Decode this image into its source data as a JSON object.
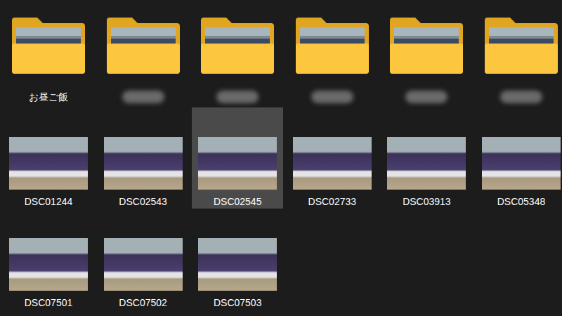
{
  "folders": [
    {
      "label": "お昼ご飯",
      "redacted": false
    },
    {
      "redacted": true
    },
    {
      "redacted": true
    },
    {
      "redacted": true
    },
    {
      "redacted": true
    },
    {
      "redacted": true
    }
  ],
  "files": [
    {
      "name": "DSC01244",
      "selected": false
    },
    {
      "name": "DSC02543",
      "selected": false
    },
    {
      "name": "DSC02545",
      "selected": true
    },
    {
      "name": "DSC02733",
      "selected": false
    },
    {
      "name": "DSC03913",
      "selected": false
    },
    {
      "name": "DSC05348",
      "selected": false
    },
    {
      "name": "DSC07501",
      "selected": false
    },
    {
      "name": "DSC07502",
      "selected": false
    },
    {
      "name": "DSC07503",
      "selected": false
    }
  ]
}
